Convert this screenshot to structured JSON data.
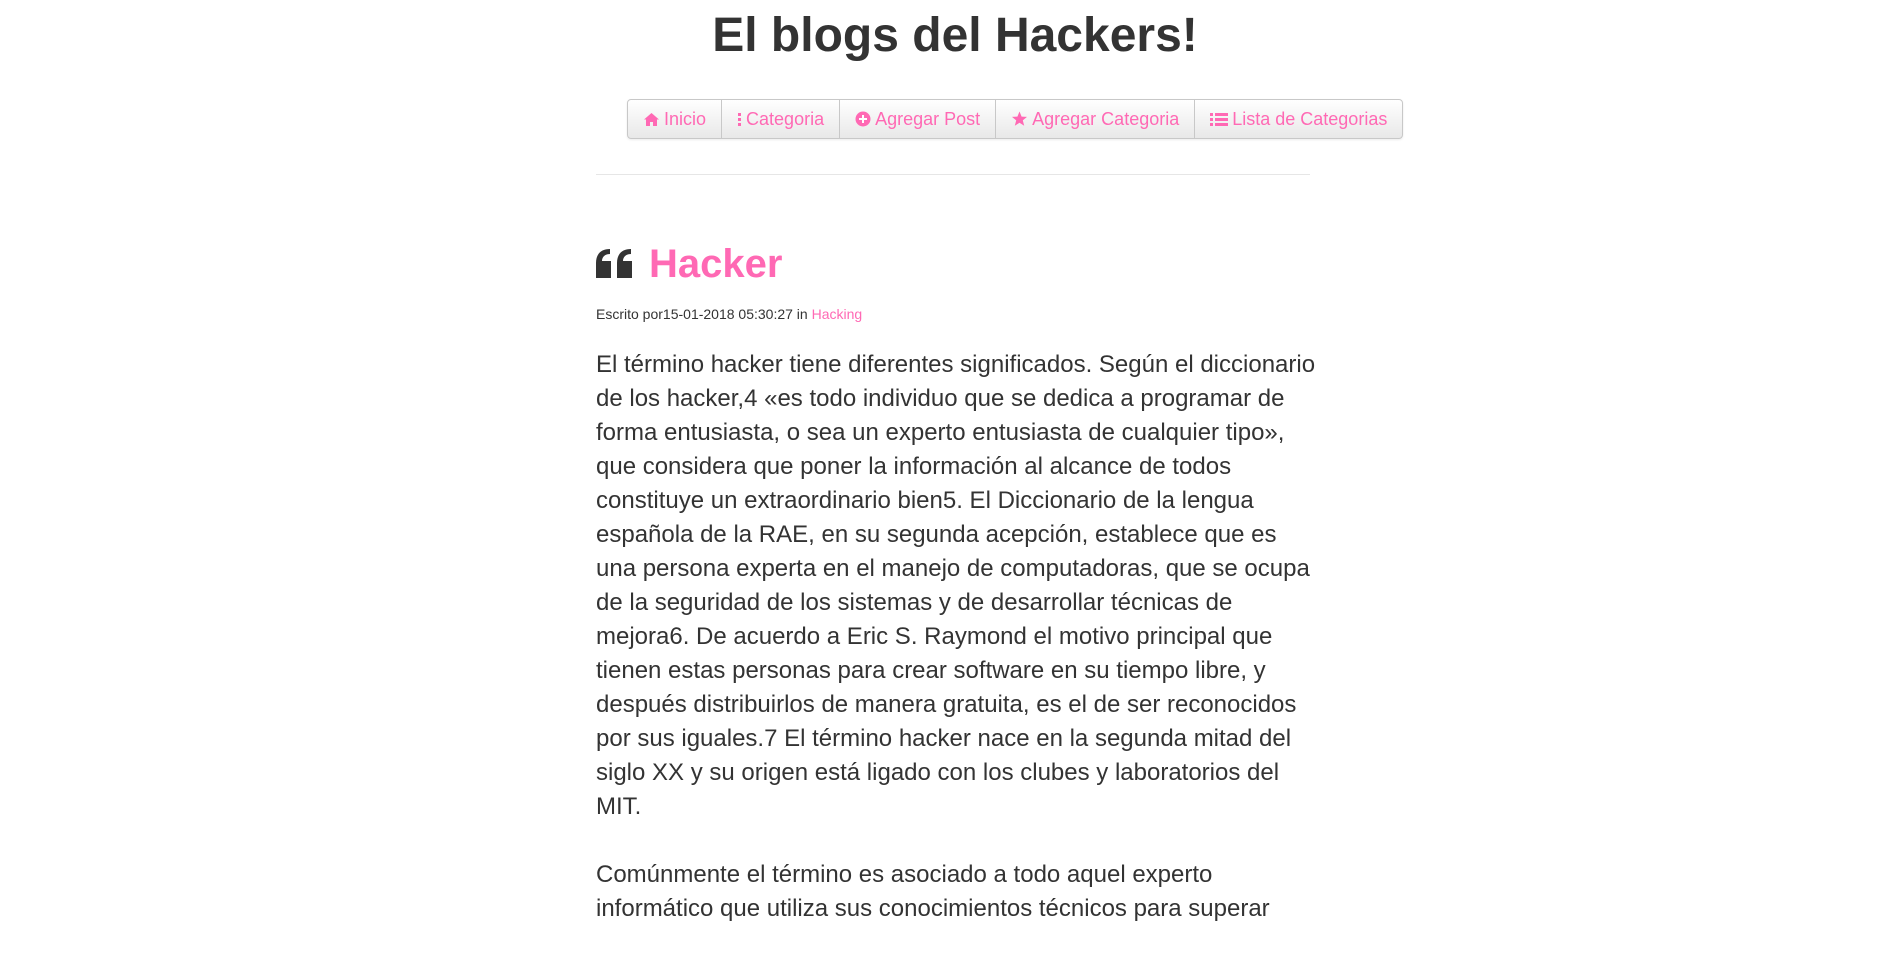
{
  "site": {
    "title": "El blogs del Hackers!"
  },
  "nav": {
    "items": [
      {
        "label": "Inicio",
        "icon": "home-icon"
      },
      {
        "label": "Categoria",
        "icon": "vertical-dots-icon"
      },
      {
        "label": "Agregar Post",
        "icon": "plus-circle-icon"
      },
      {
        "label": "Agregar Categoria",
        "icon": "star-icon"
      },
      {
        "label": "Lista de Categorias",
        "icon": "list-icon"
      }
    ]
  },
  "post": {
    "title": "Hacker",
    "meta_prefix": "Escrito por",
    "date": "15-01-2018 05:30:27",
    "meta_in": " in ",
    "category": "Hacking",
    "paragraphs": [
      "El término hacker tiene diferentes significados. Según el diccionario de los hacker,4 «es todo individuo que se dedica a programar de forma entusiasta, o sea un experto entusiasta de cualquier tipo», que considera que poner la información al alcance de todos constituye un extraordinario bien5. El Diccionario de la lengua española de la RAE, en su segunda acepción, establece que es una persona experta en el manejo de computadoras, que se ocupa de la seguridad de los sistemas y de desarrollar técnicas de mejora6. De acuerdo a Eric S. Raymond el motivo principal que tienen estas personas para crear software en su tiempo libre, y después distribuirlos de manera gratuita, es el de ser reconocidos por sus iguales.7 El término hacker nace en la segunda mitad del siglo XX y su origen está ligado con los clubes y laboratorios del MIT.",
      "Comúnmente el término es asociado a todo aquel experto informático que utiliza sus conocimientos técnicos para superar"
    ]
  },
  "colors": {
    "accent": "#ff69b4",
    "text": "#333333"
  }
}
